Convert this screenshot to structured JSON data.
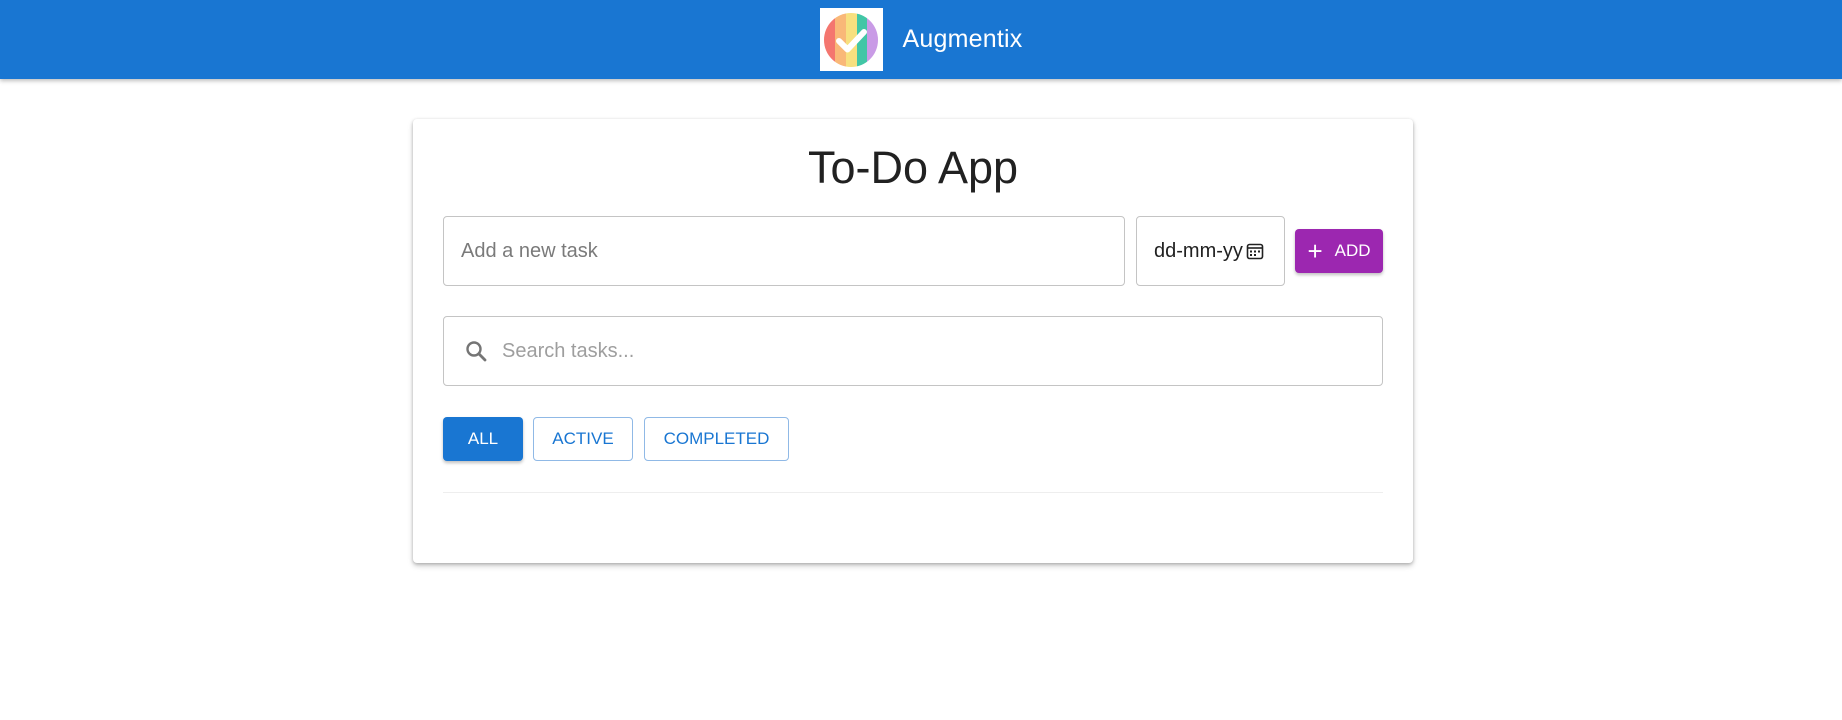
{
  "header": {
    "brand": "Augmentix",
    "logo_icon": "check-circle-logo",
    "background_color": "#1976d2"
  },
  "main": {
    "title": "To-Do App",
    "new_task": {
      "placeholder": "Add a new task",
      "value": ""
    },
    "date": {
      "placeholder": "dd-mm-yy",
      "icon": "calendar-icon"
    },
    "add_button": {
      "label": "ADD",
      "icon": "plus-icon",
      "color": "#9c27b0"
    },
    "search": {
      "placeholder": "Search tasks...",
      "value": "",
      "icon": "search-icon"
    },
    "filters": [
      {
        "label": "ALL",
        "selected": true
      },
      {
        "label": "ACTIVE",
        "selected": false
      },
      {
        "label": "COMPLETED",
        "selected": false
      }
    ],
    "tasks": []
  }
}
